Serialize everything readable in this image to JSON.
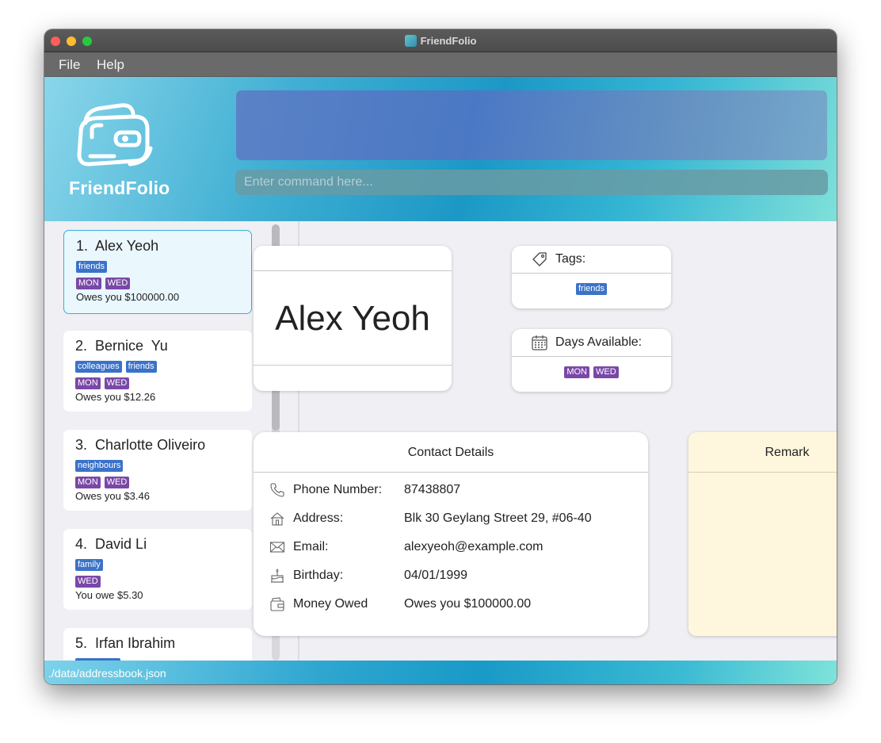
{
  "window": {
    "title": "FriendFolio",
    "app_icon": "friendfolio-app-icon"
  },
  "menu": {
    "file": "File",
    "help": "Help"
  },
  "header": {
    "logo_text": "FriendFolio",
    "command_placeholder": "Enter command here...",
    "result_text": ""
  },
  "persons": [
    {
      "index": "1.",
      "name": "Alex Yeoh",
      "tags": [
        "friends"
      ],
      "days": [
        "MON",
        "WED"
      ],
      "owe": "Owes you $100000.00"
    },
    {
      "index": "2.",
      "name": "Bernice  Yu",
      "tags": [
        "colleagues",
        "friends"
      ],
      "days": [
        "MON",
        "WED"
      ],
      "owe": "Owes you $12.26"
    },
    {
      "index": "3.",
      "name": "Charlotte Oliveiro",
      "tags": [
        "neighbours"
      ],
      "days": [
        "MON",
        "WED"
      ],
      "owe": "Owes you $3.46"
    },
    {
      "index": "4.",
      "name": "David Li",
      "tags": [
        "family"
      ],
      "days": [
        "WED"
      ],
      "owe": "You owe $5.30"
    },
    {
      "index": "5.",
      "name": "Irfan Ibrahim",
      "tags": [],
      "days": [],
      "owe": ""
    }
  ],
  "detail": {
    "name": "Alex Yeoh",
    "tags_label": "Tags:",
    "tags": [
      "friends"
    ],
    "days_label": "Days Available:",
    "days": [
      "MON",
      "WED"
    ],
    "contact_title": "Contact Details",
    "phone_label": "Phone Number:",
    "phone": "87438807",
    "address_label": "Address:",
    "address": "Blk 30 Geylang Street 29, #06-40",
    "email_label": "Email:",
    "email": "alexyeoh@example.com",
    "birthday_label": "Birthday:",
    "birthday": "04/01/1999",
    "money_label": "Money Owed",
    "money": "Owes you $100000.00",
    "remark_title": "Remark"
  },
  "status": {
    "path": "./data/addressbook.json"
  },
  "colors": {
    "accent": "#35b1d8",
    "tag": "#3b72c9",
    "day": "#7a48a8",
    "remark_bg": "#fff7dd"
  }
}
